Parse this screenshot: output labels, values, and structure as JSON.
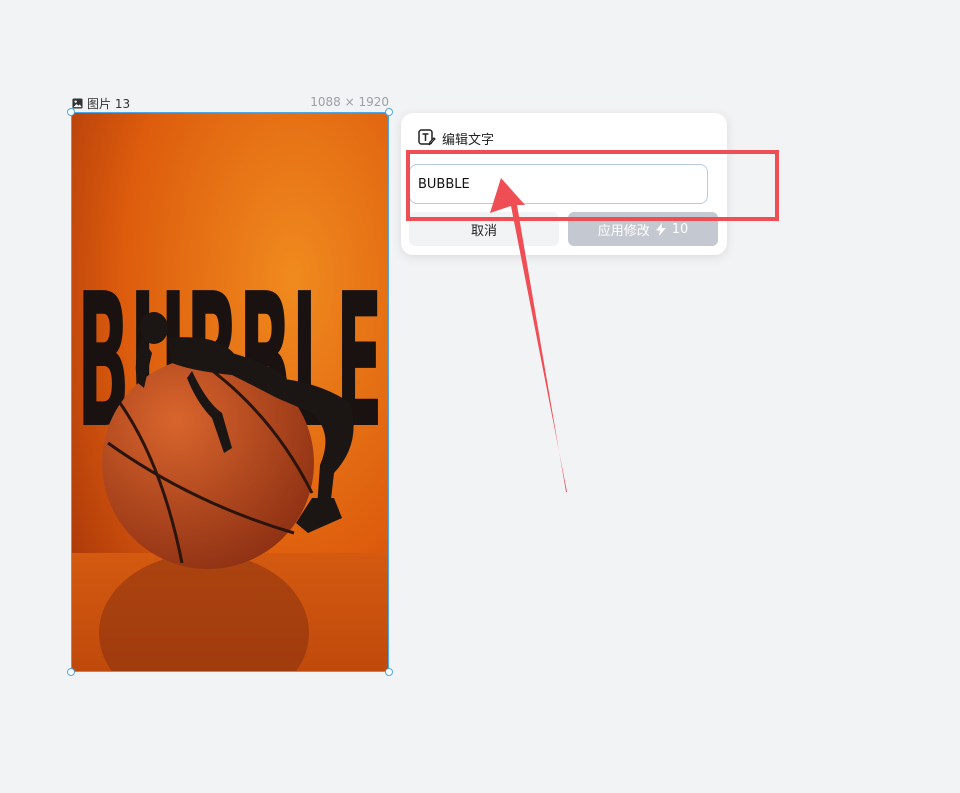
{
  "canvas": {
    "frame_name": "图片 13",
    "frame_size": "1088 × 1920",
    "frame_icon": "image-icon"
  },
  "poster": {
    "headline": "BUBBLE",
    "colors": {
      "background": "#e4650f",
      "headline": "#1a1210",
      "ball": "#b8461e"
    }
  },
  "popover": {
    "title": "编辑文字",
    "title_icon": "text-edit-icon",
    "input_value": "BUBBLE",
    "cancel_label": "取消",
    "apply_label": "应用修改",
    "apply_icon": "lightning-icon",
    "apply_cost": "10"
  },
  "colors": {
    "selection": "#4aa8e8",
    "annotation": "#f04e55",
    "apply_disabled": "#c4c8d0"
  }
}
